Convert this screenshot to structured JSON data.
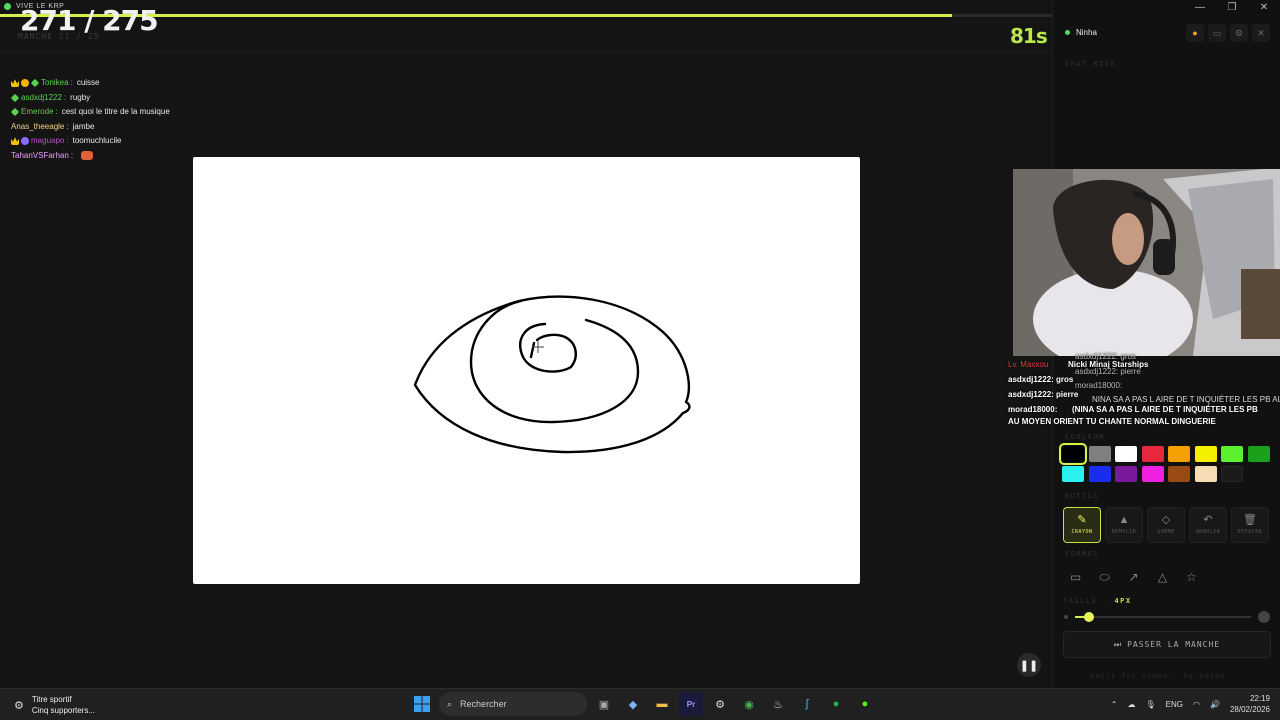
{
  "window": {
    "title": "VIVE LE KRP"
  },
  "game": {
    "round_counter": "271 / 275",
    "round_sub": "MANCHE 21 / 25",
    "timer": "81s",
    "progress_fraction": 0.905
  },
  "panel": {
    "username": "Ninha",
    "chat_label": "CHAT KICK",
    "chat": [
      {
        "user": "Tonikea",
        "user_color": "#5ad14e",
        "badges": [
          "crown",
          "gold",
          "diamond"
        ],
        "text": "cuisse"
      },
      {
        "user": "asdxdj1222",
        "user_color": "#5ad14e",
        "badges": [
          "diamond"
        ],
        "text": "rugby"
      },
      {
        "user": "Emerode",
        "user_color": "#5ad14e",
        "badges": [
          "diamond"
        ],
        "text": "cest quoi le titre de la musique"
      },
      {
        "user": "Anas_theeagle",
        "user_color": "#f2d28a",
        "badges": [],
        "text": "jambe"
      },
      {
        "user": "maguapo",
        "user_color": "#c04ad6",
        "badges": [
          "crown",
          "purple"
        ],
        "text": "toomuchlucile"
      },
      {
        "user": "TahanVSFarhan",
        "user_color": "#e6a0ff",
        "badges": [],
        "text": ""
      }
    ],
    "colors_label": "COULEUR",
    "tools_label": "OUTILS",
    "shapes_label": "FORMES",
    "size_label": "TAILLE ·",
    "size_value": "4PX",
    "size_fraction": 0.06,
    "skip_label": "PASSER LA MANCHE",
    "credit": "built for ninha · by keido"
  },
  "palette": [
    "#000000",
    "#808080",
    "#ffffff",
    "#e8283c",
    "#f5a000",
    "#f5f000",
    "#5cf030",
    "#1aa01a",
    "#2af0f0",
    "#1a2cf0",
    "#7a1a9a",
    "#f020e0",
    "#9a4a14",
    "#f5dcb4"
  ],
  "tools": [
    {
      "icon": "✎",
      "label": "CRAYON"
    },
    {
      "icon": "▲",
      "label": "REMPLIR"
    },
    {
      "icon": "◇",
      "label": "GOMME"
    },
    {
      "icon": "↶",
      "label": "ANNULER"
    },
    {
      "icon": "🗑",
      "label": "EFFACER"
    }
  ],
  "overlay": {
    "song": "Nicki Minaj Starships",
    "lines": [
      {
        "user": "Lv. Maxxou",
        "text": "",
        "user_color": "#e04040"
      },
      {
        "user": "asdxdj1222",
        "text": ": gros",
        "user_color": "#eee"
      },
      {
        "user": "asdxdj1222",
        "text": ": pierre",
        "user_color": "#eee"
      },
      {
        "user": "morad18000",
        "text": ": ",
        "user_color": "#eee"
      }
    ],
    "right_lines": [
      "asdxdj1222: gros",
      "asdxdj1222: pierre",
      "morad18000:",
      "NINA SA A PAS L AIRE DE T INQUIÉTER LES PB AU"
    ],
    "big_text_1": "(NINA SA A PAS L AIRE DE T INQUIÉTER LES PB",
    "big_text_2": "AU MOYEN ORIENT TU CHANTE NORMAL DINGUERIE"
  },
  "taskbar": {
    "notif_title": "Titre sportif",
    "notif_sub": "Cinq supporters...",
    "search_placeholder": "Rechercher",
    "lang": "ENG",
    "time": "22:19",
    "date": "28/02/2026"
  }
}
